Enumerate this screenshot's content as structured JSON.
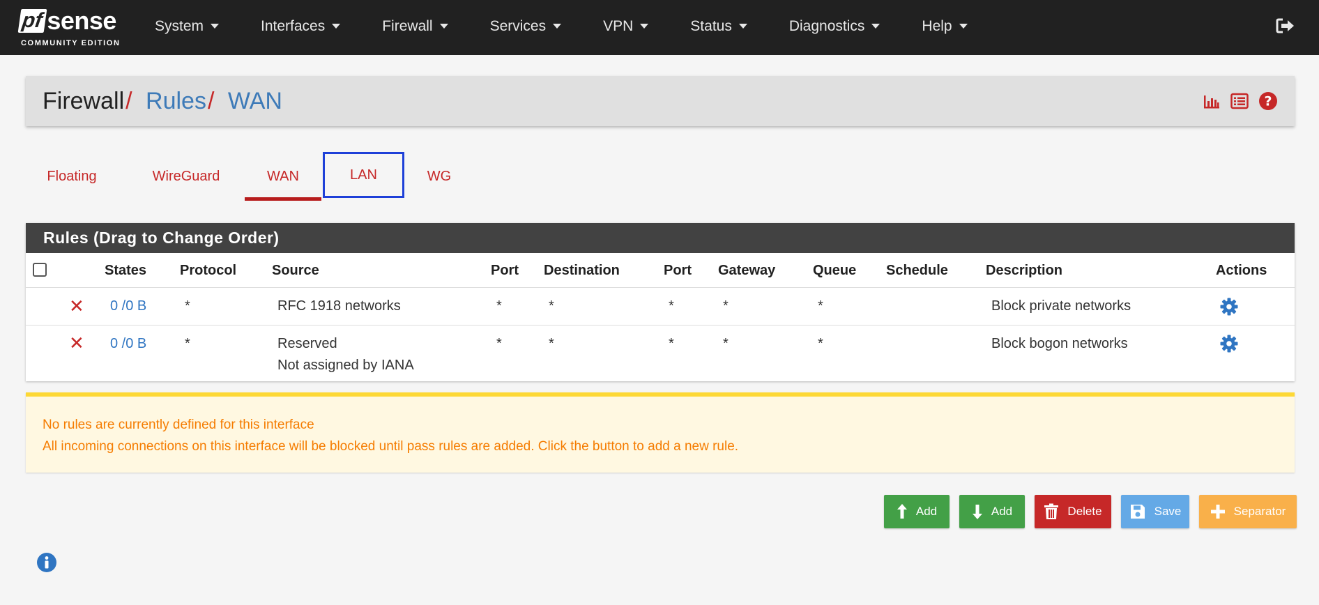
{
  "brand": {
    "logo_pf": "pf",
    "logo_sense": "sense",
    "logo_sub": "COMMUNITY EDITION"
  },
  "nav": {
    "items": [
      {
        "label": "System"
      },
      {
        "label": "Interfaces"
      },
      {
        "label": "Firewall"
      },
      {
        "label": "Services"
      },
      {
        "label": "VPN"
      },
      {
        "label": "Status"
      },
      {
        "label": "Diagnostics"
      },
      {
        "label": "Help"
      }
    ],
    "logout_icon": "sign-out-icon"
  },
  "breadcrumb": {
    "root": "Firewall",
    "sep": "/",
    "level1": "Rules",
    "level2": "WAN"
  },
  "panel_icons": [
    "bar-chart-icon",
    "list-icon",
    "help-icon"
  ],
  "tabs": [
    {
      "label": "Floating"
    },
    {
      "label": "WireGuard"
    },
    {
      "label": "WAN",
      "active": true
    },
    {
      "label": "LAN",
      "focused": true
    },
    {
      "label": "WG"
    }
  ],
  "rules": {
    "heading": "Rules (Drag to Change Order)",
    "columns": {
      "states": "States",
      "protocol": "Protocol",
      "source": "Source",
      "port": "Port",
      "destination": "Destination",
      "dport": "Port",
      "gateway": "Gateway",
      "queue": "Queue",
      "schedule": "Schedule",
      "description": "Description",
      "actions": "Actions"
    },
    "rows": [
      {
        "states": "0 /0 B",
        "protocol": "*",
        "source": "RFC 1918 networks",
        "source2": "",
        "port": "*",
        "destination": "*",
        "dport": "*",
        "gateway": "*",
        "queue": "*",
        "schedule": "",
        "description": "Block private networks"
      },
      {
        "states": "0 /0 B",
        "protocol": "*",
        "source": "Reserved",
        "source2": "Not assigned by IANA",
        "port": "*",
        "destination": "*",
        "dport": "*",
        "gateway": "*",
        "queue": "*",
        "schedule": "",
        "description": "Block bogon networks"
      }
    ]
  },
  "alert": {
    "line1": "No rules are currently defined for this interface",
    "line2": "All incoming connections on this interface will be blocked until pass rules are added. Click the button to add a new rule."
  },
  "buttons": {
    "add_top": "Add",
    "add_bottom": "Add",
    "delete": "Delete",
    "save": "Save",
    "separator": "Separator"
  },
  "colors": {
    "navbar": "#212121",
    "accent_red": "#c62828",
    "link_blue": "#3d7ab8",
    "focus_blue": "#1e40d8",
    "alert_text": "#f57c00",
    "alert_border": "#fdd835"
  }
}
